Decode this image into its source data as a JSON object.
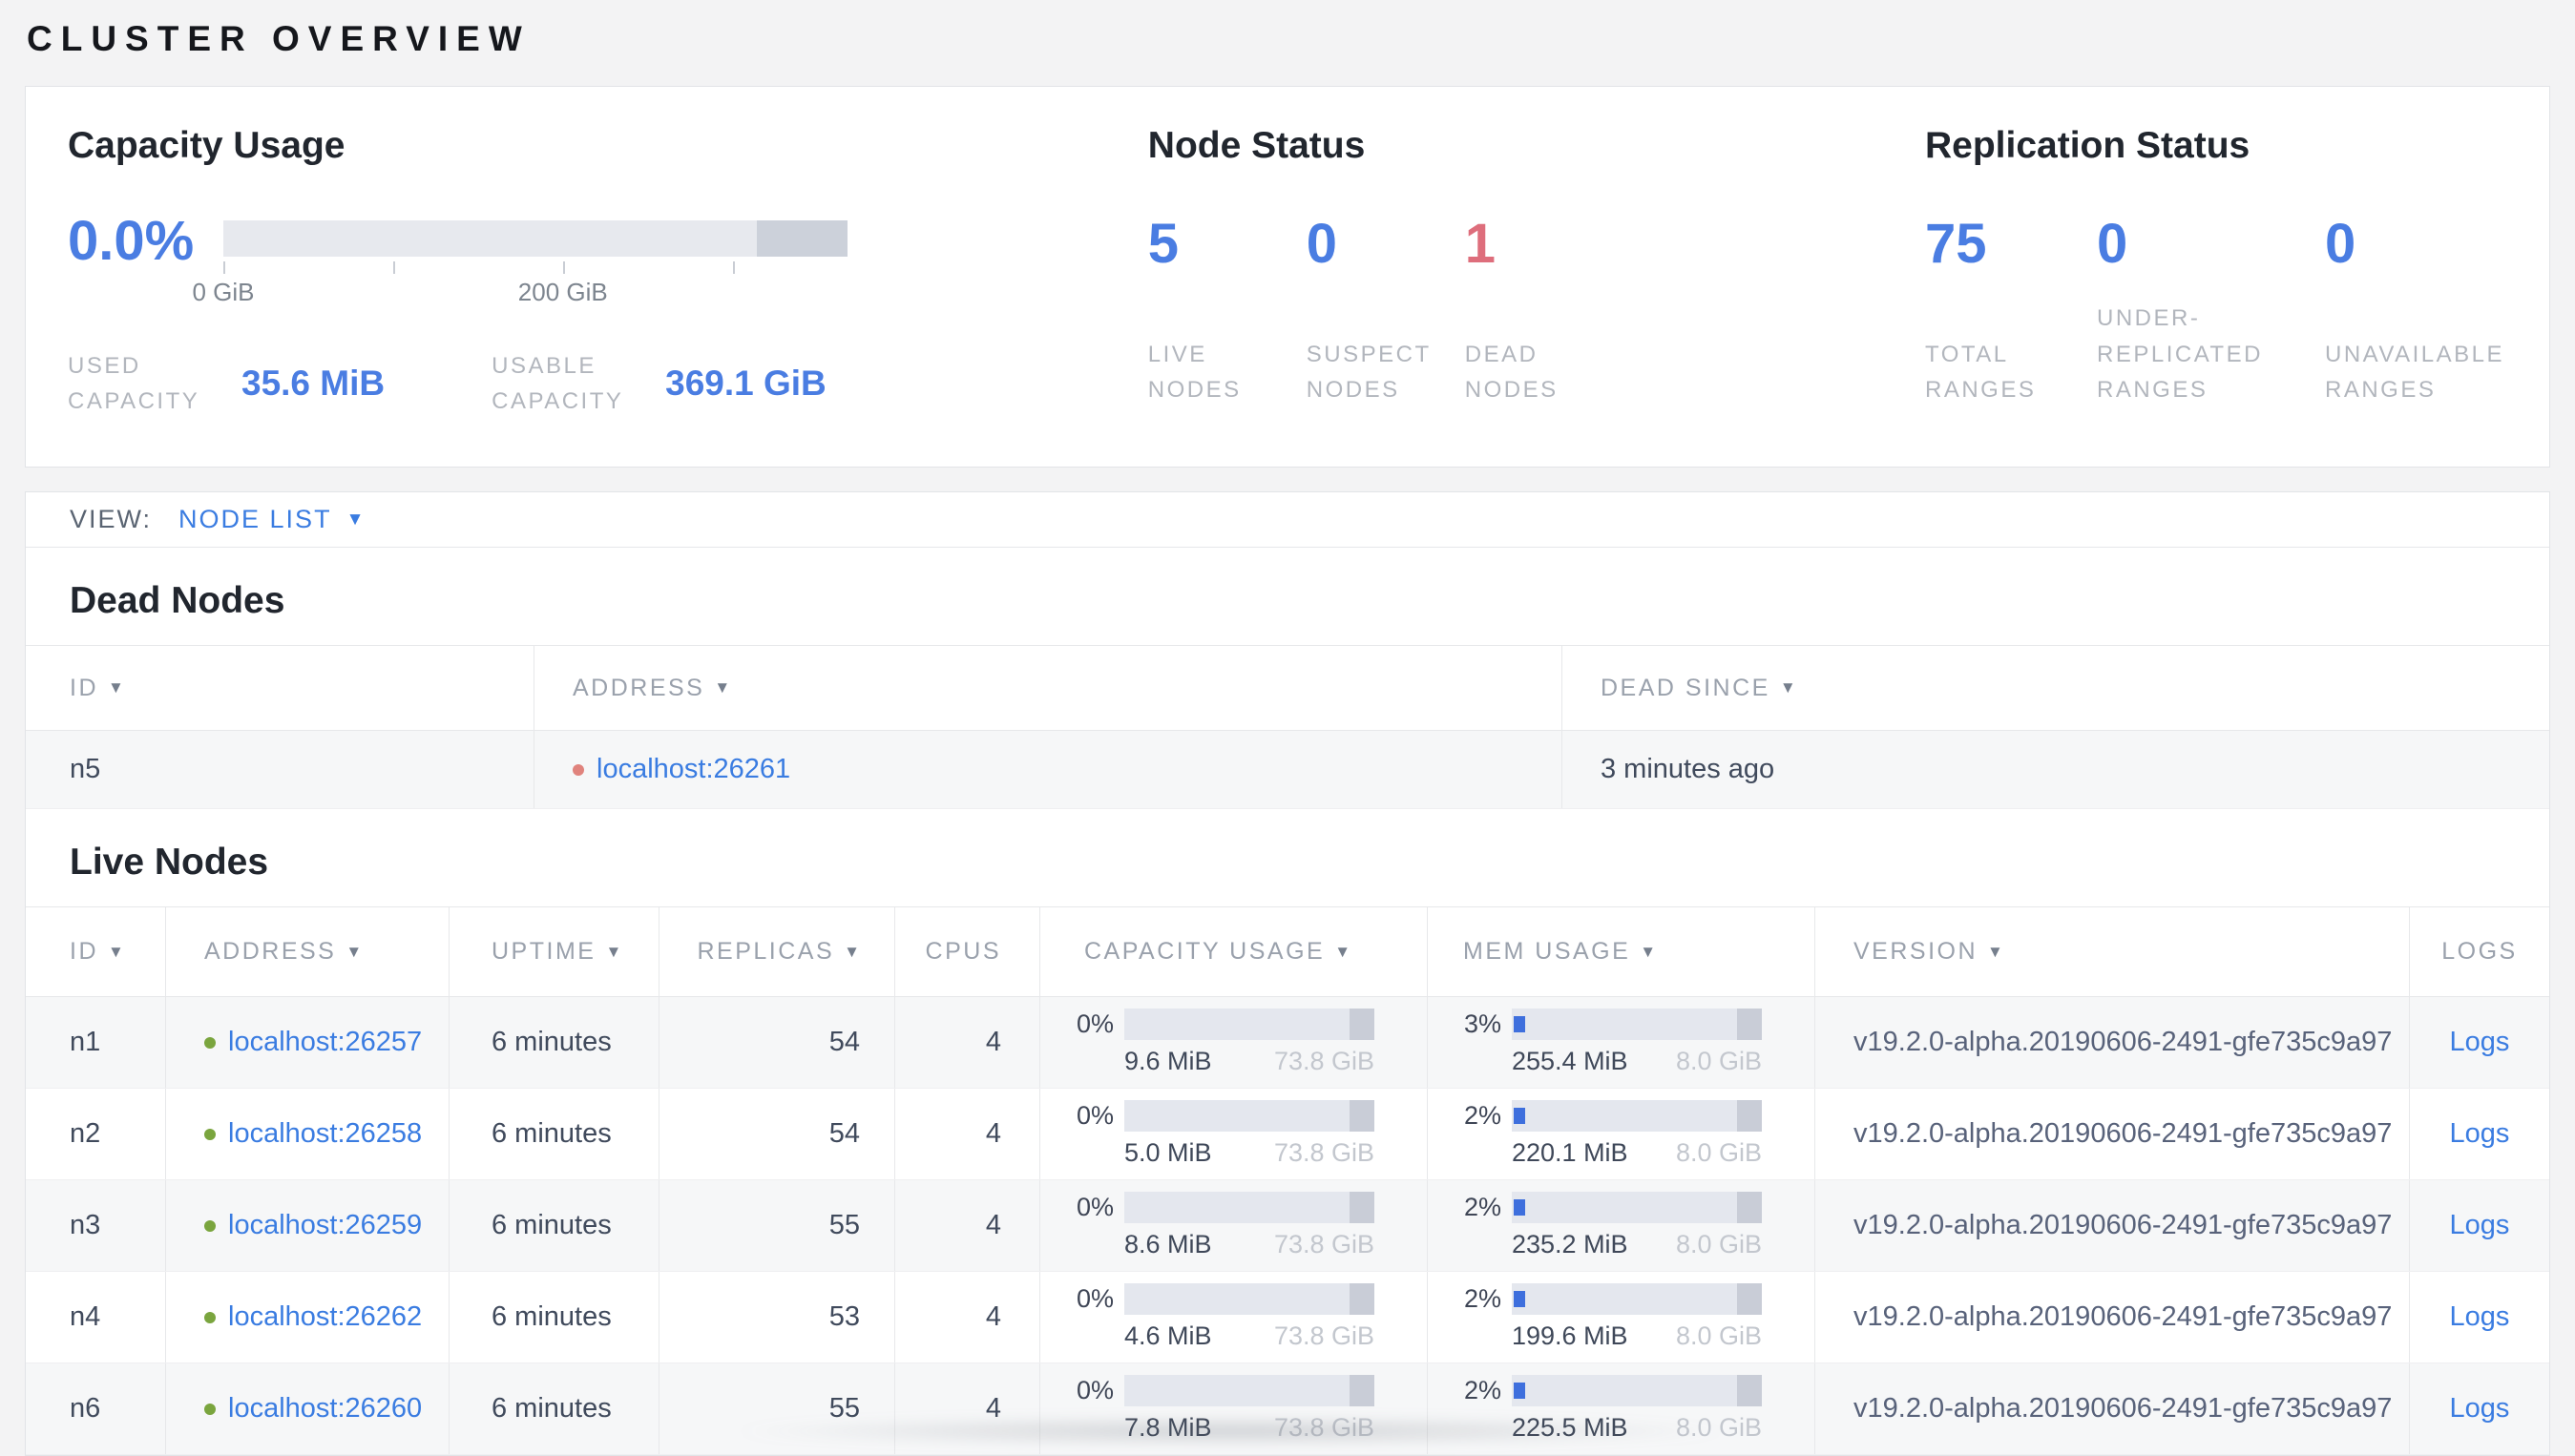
{
  "page": {
    "title": "Cluster Overview"
  },
  "colors": {
    "accent_blue": "#4a7de2",
    "link_blue": "#3a7ce1",
    "danger_red": "#de6e7c",
    "live_green": "#7aa53e",
    "dead_dot_red": "#e0837d"
  },
  "icons": {
    "sort_arrow": "▼",
    "dropdown_caret": "▼"
  },
  "capacity_usage": {
    "title": "Capacity Usage",
    "percent": "0.0%",
    "tick_labels": {
      "first": "0 GiB",
      "second": "200 GiB"
    },
    "used_label": "Used Capacity",
    "used_value": "35.6 MiB",
    "usable_label": "Usable Capacity",
    "usable_value": "369.1 GiB"
  },
  "node_status": {
    "title": "Node Status",
    "live": {
      "value": "5",
      "label": "Live Nodes"
    },
    "suspect": {
      "value": "0",
      "label": "Suspect Nodes"
    },
    "dead": {
      "value": "1",
      "label": "Dead Nodes"
    }
  },
  "replication_status": {
    "title": "Replication Status",
    "total": {
      "value": "75",
      "label": "Total Ranges"
    },
    "under": {
      "value": "0",
      "label": "Under-replicated Ranges"
    },
    "unavailable": {
      "value": "0",
      "label": "Unavailable Ranges"
    }
  },
  "view_bar": {
    "label": "View:",
    "selected": "Node List"
  },
  "dead_nodes": {
    "heading": "Dead Nodes",
    "columns": {
      "id": "ID",
      "address": "Address",
      "dead_since": "Dead Since"
    },
    "rows": [
      {
        "id": "n5",
        "address": "localhost:26261",
        "dead_since": "3 minutes ago"
      }
    ]
  },
  "live_nodes": {
    "heading": "Live Nodes",
    "columns": {
      "id": "ID",
      "address": "Address",
      "uptime": "Uptime",
      "replicas": "Replicas",
      "cpus": "CPUs",
      "capacity": "Capacity Usage",
      "mem": "Mem Usage",
      "version": "Version",
      "logs": "Logs"
    },
    "rows": [
      {
        "id": "n1",
        "address": "localhost:26257",
        "uptime": "6 minutes",
        "replicas": "54",
        "cpus": "4",
        "capacity_pct": "0%",
        "capacity_used": "9.6 MiB",
        "capacity_total": "73.8 GiB",
        "mem_pct": "3%",
        "mem_used": "255.4 MiB",
        "mem_total": "8.0 GiB",
        "version": "v19.2.0-alpha.20190606-2491-gfe735c9a97",
        "logs_label": "Logs"
      },
      {
        "id": "n2",
        "address": "localhost:26258",
        "uptime": "6 minutes",
        "replicas": "54",
        "cpus": "4",
        "capacity_pct": "0%",
        "capacity_used": "5.0 MiB",
        "capacity_total": "73.8 GiB",
        "mem_pct": "2%",
        "mem_used": "220.1 MiB",
        "mem_total": "8.0 GiB",
        "version": "v19.2.0-alpha.20190606-2491-gfe735c9a97",
        "logs_label": "Logs"
      },
      {
        "id": "n3",
        "address": "localhost:26259",
        "uptime": "6 minutes",
        "replicas": "55",
        "cpus": "4",
        "capacity_pct": "0%",
        "capacity_used": "8.6 MiB",
        "capacity_total": "73.8 GiB",
        "mem_pct": "2%",
        "mem_used": "235.2 MiB",
        "mem_total": "8.0 GiB",
        "version": "v19.2.0-alpha.20190606-2491-gfe735c9a97",
        "logs_label": "Logs"
      },
      {
        "id": "n4",
        "address": "localhost:26262",
        "uptime": "6 minutes",
        "replicas": "53",
        "cpus": "4",
        "capacity_pct": "0%",
        "capacity_used": "4.6 MiB",
        "capacity_total": "73.8 GiB",
        "mem_pct": "2%",
        "mem_used": "199.6 MiB",
        "mem_total": "8.0 GiB",
        "version": "v19.2.0-alpha.20190606-2491-gfe735c9a97",
        "logs_label": "Logs"
      },
      {
        "id": "n6",
        "address": "localhost:26260",
        "uptime": "6 minutes",
        "replicas": "55",
        "cpus": "4",
        "capacity_pct": "0%",
        "capacity_used": "7.8 MiB",
        "capacity_total": "73.8 GiB",
        "mem_pct": "2%",
        "mem_used": "225.5 MiB",
        "mem_total": "8.0 GiB",
        "version": "v19.2.0-alpha.20190606-2491-gfe735c9a97",
        "logs_label": "Logs"
      }
    ]
  }
}
